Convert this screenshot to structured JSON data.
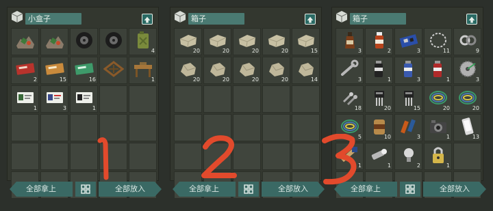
{
  "panels": [
    {
      "title": "小盒子",
      "slots": [
        {
          "icon": "scrap-pile-icon",
          "count": ""
        },
        {
          "icon": "scrap-pile-icon",
          "count": ""
        },
        {
          "icon": "tire-icon",
          "count": ""
        },
        {
          "icon": "tire-icon",
          "count": ""
        },
        {
          "icon": "jerrycan-icon",
          "count": "4"
        },
        {
          "icon": "red-ticket-icon",
          "count": "2"
        },
        {
          "icon": "orange-ticket-icon",
          "count": "15"
        },
        {
          "icon": "green-ticket-icon",
          "count": "16"
        },
        {
          "icon": "wooden-frame-icon",
          "count": ""
        },
        {
          "icon": "workbench-icon",
          "count": "1"
        },
        {
          "icon": "id-card-b-icon",
          "count": "1"
        },
        {
          "icon": "id-card-c-icon",
          "count": "3"
        },
        {
          "icon": "id-card-r-icon",
          "count": "1"
        },
        {
          "icon": "",
          "count": ""
        },
        {
          "icon": "",
          "count": ""
        },
        {
          "icon": "",
          "count": ""
        },
        {
          "icon": "",
          "count": ""
        },
        {
          "icon": "",
          "count": ""
        },
        {
          "icon": "",
          "count": ""
        },
        {
          "icon": "",
          "count": ""
        },
        {
          "icon": "",
          "count": ""
        },
        {
          "icon": "",
          "count": ""
        },
        {
          "icon": "",
          "count": ""
        },
        {
          "icon": "",
          "count": ""
        },
        {
          "icon": "",
          "count": ""
        },
        {
          "icon": "",
          "count": ""
        },
        {
          "icon": "",
          "count": ""
        },
        {
          "icon": "",
          "count": ""
        },
        {
          "icon": "",
          "count": ""
        },
        {
          "icon": "",
          "count": ""
        }
      ]
    },
    {
      "title": "箱子",
      "slots": [
        {
          "icon": "stone-block-icon",
          "count": "20"
        },
        {
          "icon": "stone-block-icon",
          "count": "20"
        },
        {
          "icon": "stone-block-icon",
          "count": "20"
        },
        {
          "icon": "stone-block-icon",
          "count": "20"
        },
        {
          "icon": "stone-block-icon",
          "count": "15"
        },
        {
          "icon": "rock-icon",
          "count": "20"
        },
        {
          "icon": "rock-icon",
          "count": "20"
        },
        {
          "icon": "rock-icon",
          "count": "20"
        },
        {
          "icon": "rock-icon",
          "count": "20"
        },
        {
          "icon": "rock-icon",
          "count": "14"
        },
        {
          "icon": "",
          "count": ""
        },
        {
          "icon": "",
          "count": ""
        },
        {
          "icon": "",
          "count": ""
        },
        {
          "icon": "",
          "count": ""
        },
        {
          "icon": "",
          "count": ""
        },
        {
          "icon": "",
          "count": ""
        },
        {
          "icon": "",
          "count": ""
        },
        {
          "icon": "",
          "count": ""
        },
        {
          "icon": "",
          "count": ""
        },
        {
          "icon": "",
          "count": ""
        },
        {
          "icon": "",
          "count": ""
        },
        {
          "icon": "",
          "count": ""
        },
        {
          "icon": "",
          "count": ""
        },
        {
          "icon": "",
          "count": ""
        },
        {
          "icon": "",
          "count": ""
        },
        {
          "icon": "",
          "count": ""
        },
        {
          "icon": "",
          "count": ""
        },
        {
          "icon": "",
          "count": ""
        },
        {
          "icon": "",
          "count": ""
        },
        {
          "icon": "",
          "count": ""
        }
      ]
    },
    {
      "title": "箱子",
      "slots": [
        {
          "icon": "whiskey-bottle-icon",
          "count": "3"
        },
        {
          "icon": "medicine-bottle-icon",
          "count": "2"
        },
        {
          "icon": "circuit-board-icon",
          "count": "3"
        },
        {
          "icon": "chain-icon",
          "count": "11"
        },
        {
          "icon": "bearing-icon",
          "count": "9"
        },
        {
          "icon": "wrench-icon",
          "count": "3"
        },
        {
          "icon": "spray-can-black-icon",
          "count": "1"
        },
        {
          "icon": "spray-can-blue-icon",
          "count": "3"
        },
        {
          "icon": "spray-can-red-icon",
          "count": "1"
        },
        {
          "icon": "saw-blade-icon",
          "count": "3"
        },
        {
          "icon": "screws-icon",
          "count": "18"
        },
        {
          "icon": "transistor-icon",
          "count": "20"
        },
        {
          "icon": "transistor-icon",
          "count": "15"
        },
        {
          "icon": "wire-coil-icon",
          "count": "20"
        },
        {
          "icon": "wire-coil-icon",
          "count": "20"
        },
        {
          "icon": "wire-coil-icon",
          "count": "5"
        },
        {
          "icon": "tin-can-icon",
          "count": "10"
        },
        {
          "icon": "batteries-icon",
          "count": "3"
        },
        {
          "icon": "camera-icon",
          "count": "1"
        },
        {
          "icon": "phone-icon",
          "count": "13"
        },
        {
          "icon": "tape-icon",
          "count": "1"
        },
        {
          "icon": "flashlight-icon",
          "count": "1"
        },
        {
          "icon": "light-bulb-icon",
          "count": "2"
        },
        {
          "icon": "padlock-icon",
          "count": "1"
        },
        {
          "icon": "",
          "count": ""
        },
        {
          "icon": "",
          "count": ""
        },
        {
          "icon": "",
          "count": ""
        },
        {
          "icon": "",
          "count": ""
        },
        {
          "icon": "",
          "count": ""
        },
        {
          "icon": "",
          "count": ""
        }
      ]
    }
  ],
  "buttons": {
    "take_all": "全部拿上",
    "put_all": "全部放入"
  },
  "annotations": [
    "1",
    "2",
    "3"
  ],
  "colors": {
    "annotation": "#e24a2c",
    "accent": "#3a6964"
  }
}
